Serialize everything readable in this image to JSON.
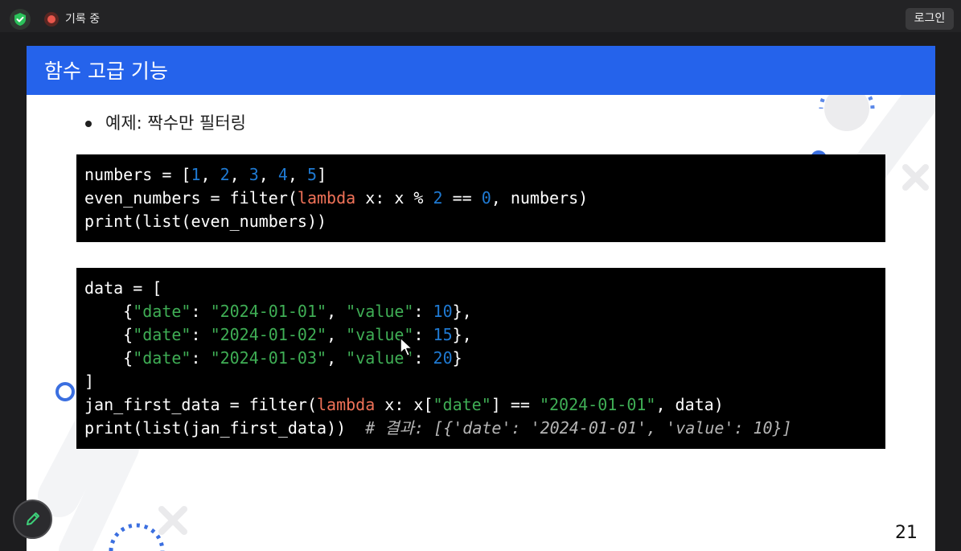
{
  "topbar": {
    "recording_label": "기록 중",
    "login_label": "로그인"
  },
  "slide": {
    "title": "함수 고급 기능",
    "bullet": "예제: 짝수만 필터링",
    "page_number": "21",
    "colors": {
      "header": "#2563eb",
      "keyword": "#f07258",
      "number": "#1f7ad3",
      "string": "#3fae55",
      "comment": "#b5b5b5"
    }
  },
  "code1": {
    "lines": [
      [
        {
          "t": "numbers = ["
        },
        {
          "t": "1",
          "c": "num"
        },
        {
          "t": ", "
        },
        {
          "t": "2",
          "c": "num"
        },
        {
          "t": ", "
        },
        {
          "t": "3",
          "c": "num"
        },
        {
          "t": ", "
        },
        {
          "t": "4",
          "c": "num"
        },
        {
          "t": ", "
        },
        {
          "t": "5",
          "c": "num"
        },
        {
          "t": "]"
        }
      ],
      [
        {
          "t": "even_numbers = filter("
        },
        {
          "t": "lambda",
          "c": "kw"
        },
        {
          "t": " x: x % "
        },
        {
          "t": "2",
          "c": "num"
        },
        {
          "t": " == "
        },
        {
          "t": "0",
          "c": "num"
        },
        {
          "t": ", numbers)"
        }
      ],
      [
        {
          "t": "print(list(even_numbers))"
        }
      ]
    ]
  },
  "code2": {
    "lines": [
      [
        {
          "t": "data = ["
        }
      ],
      [
        {
          "t": "    {"
        },
        {
          "t": "\"date\"",
          "c": "str"
        },
        {
          "t": ": "
        },
        {
          "t": "\"2024-01-01\"",
          "c": "str"
        },
        {
          "t": ", "
        },
        {
          "t": "\"value\"",
          "c": "str"
        },
        {
          "t": ": "
        },
        {
          "t": "10",
          "c": "num"
        },
        {
          "t": "},"
        }
      ],
      [
        {
          "t": "    {"
        },
        {
          "t": "\"date\"",
          "c": "str"
        },
        {
          "t": ": "
        },
        {
          "t": "\"2024-01-02\"",
          "c": "str"
        },
        {
          "t": ", "
        },
        {
          "t": "\"value\"",
          "c": "str"
        },
        {
          "t": ": "
        },
        {
          "t": "15",
          "c": "num"
        },
        {
          "t": "},"
        }
      ],
      [
        {
          "t": "    {"
        },
        {
          "t": "\"date\"",
          "c": "str"
        },
        {
          "t": ": "
        },
        {
          "t": "\"2024-01-03\"",
          "c": "str"
        },
        {
          "t": ", "
        },
        {
          "t": "\"value\"",
          "c": "str"
        },
        {
          "t": ": "
        },
        {
          "t": "20",
          "c": "num"
        },
        {
          "t": "}"
        }
      ],
      [
        {
          "t": "]"
        }
      ],
      [
        {
          "t": "jan_first_data = filter("
        },
        {
          "t": "lambda",
          "c": "kw"
        },
        {
          "t": " x: x["
        },
        {
          "t": "\"date\"",
          "c": "str"
        },
        {
          "t": "] == "
        },
        {
          "t": "\"2024-01-01\"",
          "c": "str"
        },
        {
          "t": ", data)"
        }
      ],
      [
        {
          "t": "print(list(jan_first_data))  "
        },
        {
          "t": "# 결과: [{'date': '2024-01-01', 'value': 10}]",
          "c": "cmt"
        }
      ]
    ]
  },
  "icons": {
    "shield": "shield-check-icon",
    "recording": "record-dot-icon",
    "cursor": "mouse-pointer-icon",
    "pen": "pencil-icon"
  }
}
